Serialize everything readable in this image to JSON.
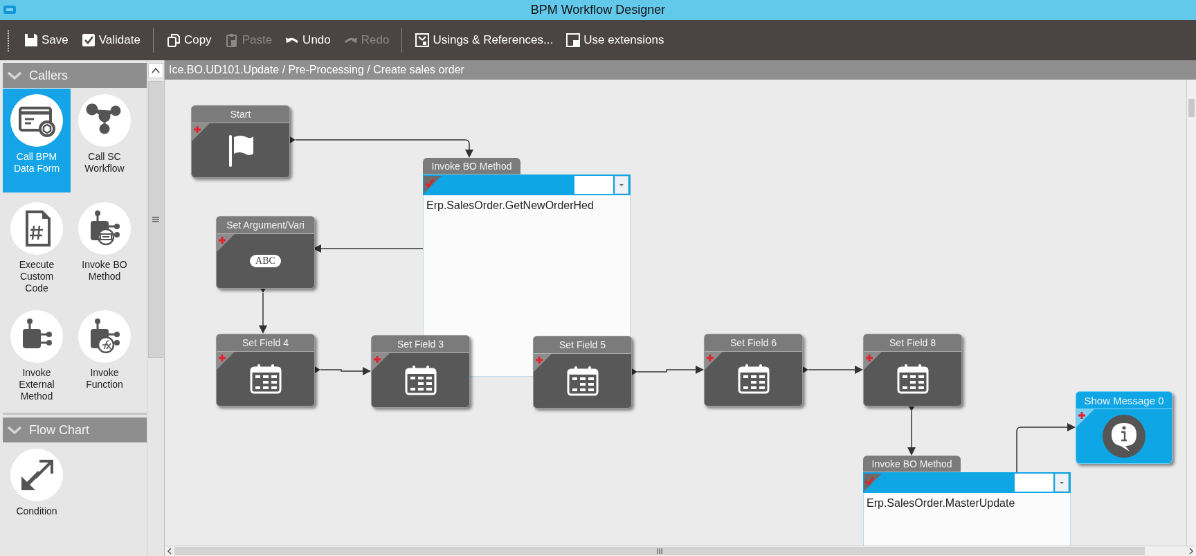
{
  "window": {
    "title": "BPM Workflow Designer"
  },
  "toolbar": [
    {
      "group": [
        {
          "label": "Save",
          "kind": "save",
          "disabled": false
        },
        {
          "label": "Validate",
          "kind": "validate",
          "disabled": false
        }
      ]
    },
    {
      "group": [
        {
          "label": "Copy",
          "kind": "copy",
          "disabled": false
        },
        {
          "label": "Paste",
          "kind": "paste",
          "disabled": true
        },
        {
          "label": "Undo",
          "kind": "undo",
          "disabled": false
        },
        {
          "label": "Redo",
          "kind": "redo",
          "disabled": true
        }
      ]
    },
    {
      "group": [
        {
          "label": "Usings & References...",
          "kind": "usings",
          "disabled": false
        },
        {
          "label": "Use extensions",
          "kind": "extensions",
          "disabled": false
        }
      ]
    }
  ],
  "sidebar": {
    "sections": [
      {
        "title": "Callers",
        "expanded": true,
        "items": [
          {
            "label": "Call BPM Data Form",
            "kind": "form",
            "selected": true
          },
          {
            "label": "Call SC Workflow",
            "kind": "workflow",
            "selected": false
          },
          {
            "label": "Execute Custom Code",
            "kind": "code",
            "selected": false
          },
          {
            "label": "Invoke BO Method",
            "kind": "method",
            "selected": false
          },
          {
            "label": "Invoke External Method",
            "kind": "external",
            "selected": false
          },
          {
            "label": "Invoke Function",
            "kind": "function",
            "selected": false
          }
        ]
      },
      {
        "title": "Flow Chart",
        "expanded": true,
        "items": [
          {
            "label": "Condition",
            "kind": "condition",
            "selected": false
          }
        ]
      }
    ]
  },
  "canvas": {
    "breadcrumb": "Ice.BO.UD101.Update / Pre-Processing / Create sales order",
    "nodes": [
      {
        "kind": "start",
        "title": "Start",
        "validated": false
      },
      {
        "kind": "invoke",
        "title": "Invoke BO Method",
        "validated": true,
        "method": "Erp.SalesOrder.GetNewOrderHed"
      },
      {
        "kind": "argument",
        "title": "Set Argument/Vari",
        "validated": false,
        "badge": "ABC"
      },
      {
        "kind": "field",
        "title": "Set Field 4",
        "validated": false
      },
      {
        "kind": "field",
        "title": "Set Field 3",
        "validated": false
      },
      {
        "kind": "field",
        "title": "Set Field 5",
        "validated": false
      },
      {
        "kind": "field",
        "title": "Set Field 6",
        "validated": false
      },
      {
        "kind": "field",
        "title": "Set Field 8",
        "validated": false
      },
      {
        "kind": "invoke",
        "title": "Invoke BO Method",
        "validated": true,
        "method": "Erp.SalesOrder.MasterUpdate"
      },
      {
        "kind": "message",
        "title": "Show Message 0",
        "validated": false
      }
    ]
  }
}
